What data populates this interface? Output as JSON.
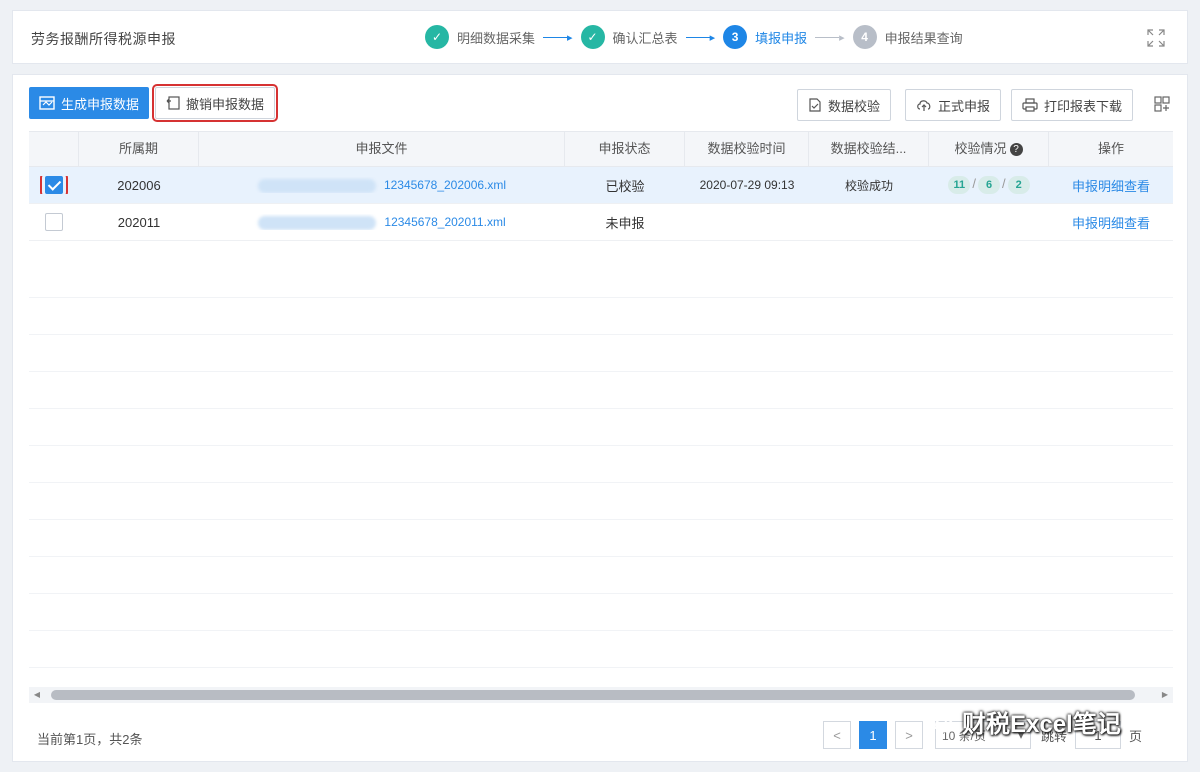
{
  "header": {
    "title": "劳务报酬所得税源申报",
    "steps": [
      {
        "num": "1",
        "label": "明细数据采集",
        "state": "done"
      },
      {
        "num": "2",
        "label": "确认汇总表",
        "state": "done"
      },
      {
        "num": "3",
        "label": "填报申报",
        "state": "active"
      },
      {
        "num": "4",
        "label": "申报结果查询",
        "state": "todo"
      }
    ]
  },
  "toolbar": {
    "generate_label": "生成申报数据",
    "revoke_label": "撤销申报数据",
    "check_label": "数据校验",
    "declare_label": "正式申报",
    "print_label": "打印报表下载"
  },
  "table": {
    "headers": {
      "period": "所属期",
      "file": "申报文件",
      "status": "申报状态",
      "time": "数据校验时间",
      "result": "数据校验结...",
      "audit": "校验情况",
      "op": "操作"
    },
    "rows": [
      {
        "checked": true,
        "period": "202006",
        "file": "12345678_202006.xml",
        "status": "已校验",
        "time": "2020-07-29 09:13",
        "result": "校验成功",
        "audit": [
          "11",
          "6",
          "2"
        ],
        "op": "申报明细查看"
      },
      {
        "checked": false,
        "period": "202011",
        "file": "12345678_202011.xml",
        "status": "未申报",
        "time": "",
        "result": "",
        "audit": [],
        "op": "申报明细查看"
      }
    ]
  },
  "footer": {
    "summary": "当前第1页，共2条",
    "current_page": "1",
    "page_size": "10 条/页",
    "jump_label": "跳转",
    "jump_value": "1",
    "page_unit": "页"
  },
  "watermark": {
    "text": "财税Excel笔记"
  },
  "colors": {
    "primary": "#2b8ae6",
    "success": "#26b7a4",
    "highlight": "#d63232"
  }
}
